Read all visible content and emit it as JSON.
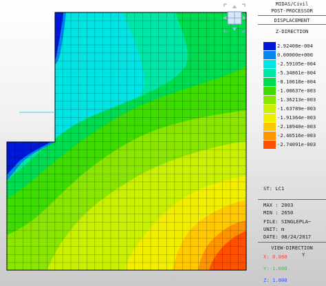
{
  "header": {
    "line1": "MIDAS/Civil",
    "line2": "POST-PROCESSOR",
    "line3": "DISPLACEMENT",
    "line4": "Z-DIRECTION"
  },
  "legend": {
    "entries": [
      {
        "value": "2.92408e-004",
        "color": "#0018d8"
      },
      {
        "value": "0.00000e+000",
        "color": "#0088f0"
      },
      {
        "value": "-2.59105e-004",
        "color": "#00e4e4"
      },
      {
        "value": "-5.34861e-004",
        "color": "#00e6a6"
      },
      {
        "value": "-8.10618e-004",
        "color": "#00dc50"
      },
      {
        "value": "-1.08637e-003",
        "color": "#3edc00"
      },
      {
        "value": "-1.36213e-003",
        "color": "#8ae600"
      },
      {
        "value": "-1.63789e-003",
        "color": "#c8f000"
      },
      {
        "value": "-1.91364e-003",
        "color": "#f2ee00"
      },
      {
        "value": "-2.18940e-003",
        "color": "#ffc800"
      },
      {
        "value": "-2.46516e-003",
        "color": "#ff9400"
      },
      {
        "value": "-2.74091e-003",
        "color": "#ff5000"
      }
    ]
  },
  "info": {
    "st": "ST: LC1",
    "max": "MAX : 2003",
    "min": "MIN : 2650",
    "file": "FILE: SINGLEPLA~",
    "unit": "UNIT: m",
    "date": "DATE: 08/24/2017"
  },
  "view_direction": {
    "title": "VIEW-DIRECTION",
    "axis_letter": "Y",
    "x": "X: 0.000",
    "y": "Y:-1.000",
    "z": "Z: 1.000",
    "x_color": "#ff4040",
    "y_color": "#40c040",
    "z_color": "#3050ff"
  }
}
